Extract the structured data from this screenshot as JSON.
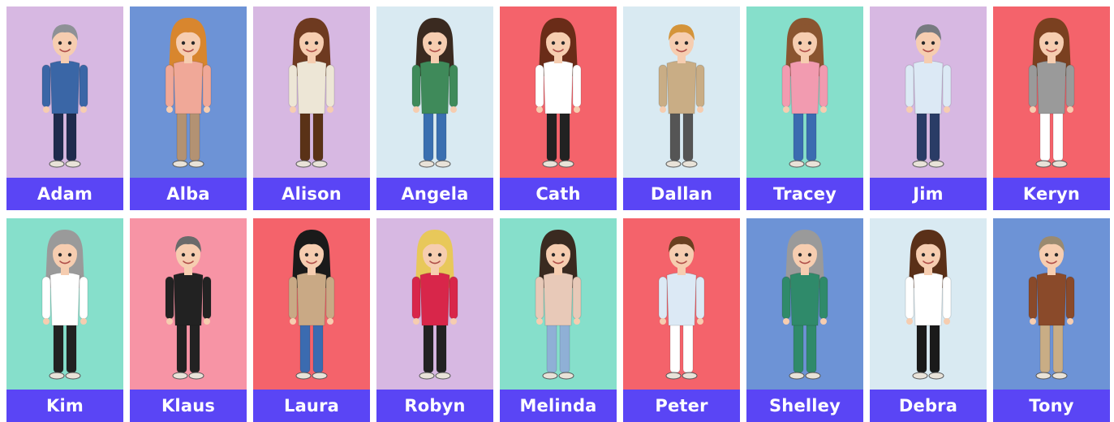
{
  "colors": {
    "label_bg": "#5a45f5",
    "label_text": "#ffffff",
    "lavender": "#d7b8e2",
    "blue": "#6d93d6",
    "pale": "#d9eaf2",
    "red": "#f4636b",
    "mint": "#86dfcb",
    "pink": "#f794a5"
  },
  "characters": [
    {
      "name": "Adam",
      "bg": "#d7b8e2",
      "hair": "#8e9196",
      "top": "#3a66a6",
      "bottom": "#1f2b4d",
      "icon": "avatar-male-icon"
    },
    {
      "name": "Alba",
      "bg": "#6d93d6",
      "hair": "#d8862e",
      "top": "#f0a898",
      "bottom": "#b39273",
      "icon": "avatar-female-icon"
    },
    {
      "name": "Alison",
      "bg": "#d7b8e2",
      "hair": "#6e3a20",
      "top": "#ede6d6",
      "bottom": "#5a3217",
      "icon": "avatar-female-icon"
    },
    {
      "name": "Angela",
      "bg": "#d9eaf2",
      "hair": "#3a2a20",
      "top": "#3f8a5a",
      "bottom": "#3a6fb0",
      "icon": "avatar-female-icon"
    },
    {
      "name": "Cath",
      "bg": "#f4636b",
      "hair": "#6a2c18",
      "top": "#ffffff",
      "bottom": "#222222",
      "icon": "avatar-female-icon"
    },
    {
      "name": "Dallan",
      "bg": "#d9eaf2",
      "hair": "#d4943a",
      "top": "#c9ad85",
      "bottom": "#555555",
      "icon": "avatar-male-icon"
    },
    {
      "name": "Tracey",
      "bg": "#86dfcb",
      "hair": "#8a5530",
      "top": "#f29bb0",
      "bottom": "#3b6bb0",
      "icon": "avatar-female-icon"
    },
    {
      "name": "Jim",
      "bg": "#d7b8e2",
      "hair": "#777a80",
      "top": "#dce9f5",
      "bottom": "#2a3c66",
      "icon": "avatar-male-icon"
    },
    {
      "name": "Keryn",
      "bg": "#f4636b",
      "hair": "#7a4020",
      "top": "#9a9a9a",
      "bottom": "#ffffff",
      "icon": "avatar-female-icon"
    },
    {
      "name": "Kim",
      "bg": "#86dfcb",
      "hair": "#9a9a9a",
      "top": "#ffffff",
      "bottom": "#222222",
      "icon": "avatar-female-icon"
    },
    {
      "name": "Klaus",
      "bg": "#f794a5",
      "hair": "#6a6a6a",
      "top": "#222222",
      "bottom": "#222222",
      "icon": "avatar-male-icon"
    },
    {
      "name": "Laura",
      "bg": "#f4636b",
      "hair": "#1a1a1a",
      "top": "#c9a985",
      "bottom": "#3b6bb0",
      "icon": "avatar-female-icon"
    },
    {
      "name": "Robyn",
      "bg": "#d7b8e2",
      "hair": "#e8c85a",
      "top": "#d8264a",
      "bottom": "#222222",
      "icon": "avatar-female-icon"
    },
    {
      "name": "Melinda",
      "bg": "#86dfcb",
      "hair": "#3a2a20",
      "top": "#e8c9b8",
      "bottom": "#8fb0d6",
      "icon": "avatar-female-icon"
    },
    {
      "name": "Peter",
      "bg": "#f4636b",
      "hair": "#6a4020",
      "top": "#dce9f5",
      "bottom": "#ffffff",
      "icon": "avatar-male-icon"
    },
    {
      "name": "Shelley",
      "bg": "#6d93d6",
      "hair": "#9a9a9a",
      "top": "#2f8a6a",
      "bottom": "#2f8a6a",
      "icon": "avatar-female-icon"
    },
    {
      "name": "Debra",
      "bg": "#d9eaf2",
      "hair": "#5a3018",
      "top": "#ffffff",
      "bottom": "#1a1a1a",
      "icon": "avatar-female-icon"
    },
    {
      "name": "Tony",
      "bg": "#6d93d6",
      "hair": "#9a8a70",
      "top": "#8a4a2a",
      "bottom": "#c9ad85",
      "icon": "avatar-male-icon"
    }
  ]
}
